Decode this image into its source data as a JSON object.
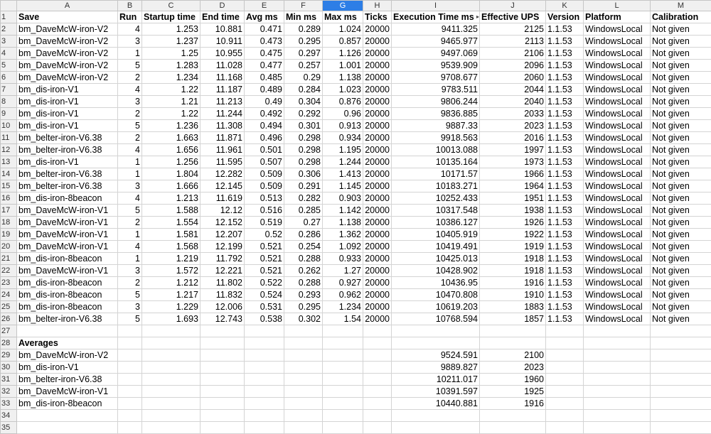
{
  "columns": [
    "A",
    "B",
    "C",
    "D",
    "E",
    "F",
    "G",
    "H",
    "I",
    "J",
    "K",
    "L",
    "M"
  ],
  "selected_column": "G",
  "headers": [
    "Save",
    "Run",
    "Startup time",
    "End time",
    "Avg ms",
    "Min ms",
    "Max ms",
    "Ticks",
    "Execution Time ms",
    "Effective UPS",
    "Version",
    "Platform",
    "Calibration"
  ],
  "rows": [
    [
      "bm_DaveMcW-iron-V2",
      "4",
      "1.253",
      "10.881",
      "0.471",
      "0.289",
      "1.024",
      "20000",
      "9411.325",
      "2125",
      "1.1.53",
      "WindowsLocal",
      "Not given"
    ],
    [
      "bm_DaveMcW-iron-V2",
      "3",
      "1.237",
      "10.911",
      "0.473",
      "0.295",
      "0.857",
      "20000",
      "9465.977",
      "2113",
      "1.1.53",
      "WindowsLocal",
      "Not given"
    ],
    [
      "bm_DaveMcW-iron-V2",
      "1",
      "1.25",
      "10.955",
      "0.475",
      "0.297",
      "1.126",
      "20000",
      "9497.069",
      "2106",
      "1.1.53",
      "WindowsLocal",
      "Not given"
    ],
    [
      "bm_DaveMcW-iron-V2",
      "5",
      "1.283",
      "11.028",
      "0.477",
      "0.257",
      "1.001",
      "20000",
      "9539.909",
      "2096",
      "1.1.53",
      "WindowsLocal",
      "Not given"
    ],
    [
      "bm_DaveMcW-iron-V2",
      "2",
      "1.234",
      "11.168",
      "0.485",
      "0.29",
      "1.138",
      "20000",
      "9708.677",
      "2060",
      "1.1.53",
      "WindowsLocal",
      "Not given"
    ],
    [
      "bm_dis-iron-V1",
      "4",
      "1.22",
      "11.187",
      "0.489",
      "0.284",
      "1.023",
      "20000",
      "9783.511",
      "2044",
      "1.1.53",
      "WindowsLocal",
      "Not given"
    ],
    [
      "bm_dis-iron-V1",
      "3",
      "1.21",
      "11.213",
      "0.49",
      "0.304",
      "0.876",
      "20000",
      "9806.244",
      "2040",
      "1.1.53",
      "WindowsLocal",
      "Not given"
    ],
    [
      "bm_dis-iron-V1",
      "2",
      "1.22",
      "11.244",
      "0.492",
      "0.292",
      "0.96",
      "20000",
      "9836.885",
      "2033",
      "1.1.53",
      "WindowsLocal",
      "Not given"
    ],
    [
      "bm_dis-iron-V1",
      "5",
      "1.236",
      "11.308",
      "0.494",
      "0.301",
      "0.913",
      "20000",
      "9887.33",
      "2023",
      "1.1.53",
      "WindowsLocal",
      "Not given"
    ],
    [
      "bm_belter-iron-V6.38",
      "2",
      "1.663",
      "11.871",
      "0.496",
      "0.298",
      "0.934",
      "20000",
      "9918.563",
      "2016",
      "1.1.53",
      "WindowsLocal",
      "Not given"
    ],
    [
      "bm_belter-iron-V6.38",
      "4",
      "1.656",
      "11.961",
      "0.501",
      "0.298",
      "1.195",
      "20000",
      "10013.088",
      "1997",
      "1.1.53",
      "WindowsLocal",
      "Not given"
    ],
    [
      "bm_dis-iron-V1",
      "1",
      "1.256",
      "11.595",
      "0.507",
      "0.298",
      "1.244",
      "20000",
      "10135.164",
      "1973",
      "1.1.53",
      "WindowsLocal",
      "Not given"
    ],
    [
      "bm_belter-iron-V6.38",
      "1",
      "1.804",
      "12.282",
      "0.509",
      "0.306",
      "1.413",
      "20000",
      "10171.57",
      "1966",
      "1.1.53",
      "WindowsLocal",
      "Not given"
    ],
    [
      "bm_belter-iron-V6.38",
      "3",
      "1.666",
      "12.145",
      "0.509",
      "0.291",
      "1.145",
      "20000",
      "10183.271",
      "1964",
      "1.1.53",
      "WindowsLocal",
      "Not given"
    ],
    [
      "bm_dis-iron-8beacon",
      "4",
      "1.213",
      "11.619",
      "0.513",
      "0.282",
      "0.903",
      "20000",
      "10252.433",
      "1951",
      "1.1.53",
      "WindowsLocal",
      "Not given"
    ],
    [
      "bm_DaveMcW-iron-V1",
      "5",
      "1.588",
      "12.12",
      "0.516",
      "0.285",
      "1.142",
      "20000",
      "10317.548",
      "1938",
      "1.1.53",
      "WindowsLocal",
      "Not given"
    ],
    [
      "bm_DaveMcW-iron-V1",
      "2",
      "1.554",
      "12.152",
      "0.519",
      "0.27",
      "1.138",
      "20000",
      "10386.127",
      "1926",
      "1.1.53",
      "WindowsLocal",
      "Not given"
    ],
    [
      "bm_DaveMcW-iron-V1",
      "1",
      "1.581",
      "12.207",
      "0.52",
      "0.286",
      "1.362",
      "20000",
      "10405.919",
      "1922",
      "1.1.53",
      "WindowsLocal",
      "Not given"
    ],
    [
      "bm_DaveMcW-iron-V1",
      "4",
      "1.568",
      "12.199",
      "0.521",
      "0.254",
      "1.092",
      "20000",
      "10419.491",
      "1919",
      "1.1.53",
      "WindowsLocal",
      "Not given"
    ],
    [
      "bm_dis-iron-8beacon",
      "1",
      "1.219",
      "11.792",
      "0.521",
      "0.288",
      "0.933",
      "20000",
      "10425.013",
      "1918",
      "1.1.53",
      "WindowsLocal",
      "Not given"
    ],
    [
      "bm_DaveMcW-iron-V1",
      "3",
      "1.572",
      "12.221",
      "0.521",
      "0.262",
      "1.27",
      "20000",
      "10428.902",
      "1918",
      "1.1.53",
      "WindowsLocal",
      "Not given"
    ],
    [
      "bm_dis-iron-8beacon",
      "2",
      "1.212",
      "11.802",
      "0.522",
      "0.288",
      "0.927",
      "20000",
      "10436.95",
      "1916",
      "1.1.53",
      "WindowsLocal",
      "Not given"
    ],
    [
      "bm_dis-iron-8beacon",
      "5",
      "1.217",
      "11.832",
      "0.524",
      "0.293",
      "0.962",
      "20000",
      "10470.808",
      "1910",
      "1.1.53",
      "WindowsLocal",
      "Not given"
    ],
    [
      "bm_dis-iron-8beacon",
      "3",
      "1.229",
      "12.006",
      "0.531",
      "0.295",
      "1.234",
      "20000",
      "10619.203",
      "1883",
      "1.1.53",
      "WindowsLocal",
      "Not given"
    ],
    [
      "bm_belter-iron-V6.38",
      "5",
      "1.693",
      "12.743",
      "0.538",
      "0.302",
      "1.54",
      "20000",
      "10768.594",
      "1857",
      "1.1.53",
      "WindowsLocal",
      "Not given"
    ]
  ],
  "averages_label": "Averages",
  "averages": [
    [
      "bm_DaveMcW-iron-V2",
      "9524.591",
      "2100"
    ],
    [
      "bm_dis-iron-V1",
      "9889.827",
      "2023"
    ],
    [
      "bm_belter-iron-V6.38",
      "10211.017",
      "1960"
    ],
    [
      "bm_DaveMcW-iron-V1",
      "10391.597",
      "1925"
    ],
    [
      "bm_dis-iron-8beacon",
      "10440.881",
      "1916"
    ]
  ],
  "total_rows_visible": 35
}
